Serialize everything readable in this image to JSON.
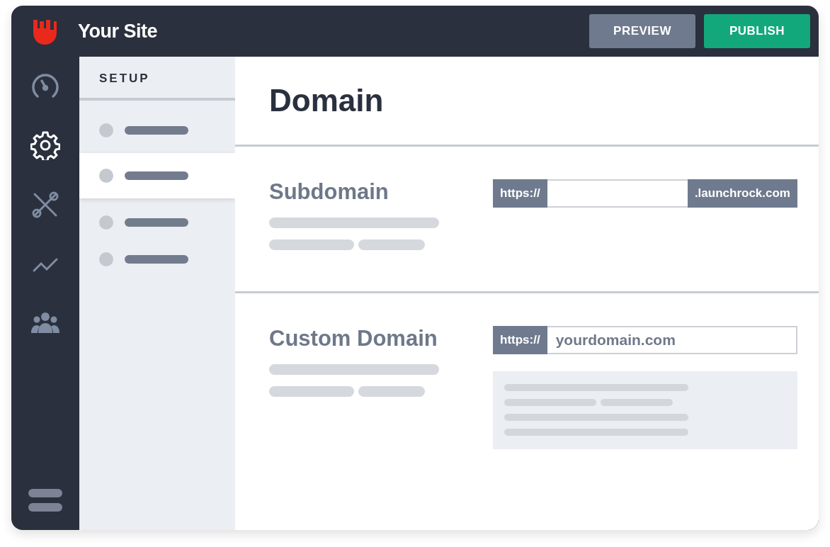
{
  "header": {
    "site_name": "Your Site",
    "buttons": [
      {
        "label": "PREVIEW",
        "kind": "secondary"
      },
      {
        "label": "PUBLISH",
        "kind": "primary"
      }
    ]
  },
  "rail": [
    {
      "kind": "gauge",
      "selected": false
    },
    {
      "kind": "gear",
      "selected": true
    },
    {
      "kind": "tools",
      "selected": false
    },
    {
      "kind": "chart",
      "selected": false
    },
    {
      "kind": "people",
      "selected": false
    }
  ],
  "sidebar": {
    "title": "SETUP",
    "items": [
      {
        "selected": false
      },
      {
        "selected": true
      },
      {
        "selected": false
      },
      {
        "selected": false
      }
    ]
  },
  "page_title": "Domain",
  "sections": [
    {
      "heading": "Subdomain",
      "prefix": "https://",
      "suffix": ".launchrock.com",
      "info_box": false
    },
    {
      "heading": "Custom Domain",
      "prefix": "https://",
      "placeholder": "yourdomain.com",
      "info_box": true
    }
  ]
}
